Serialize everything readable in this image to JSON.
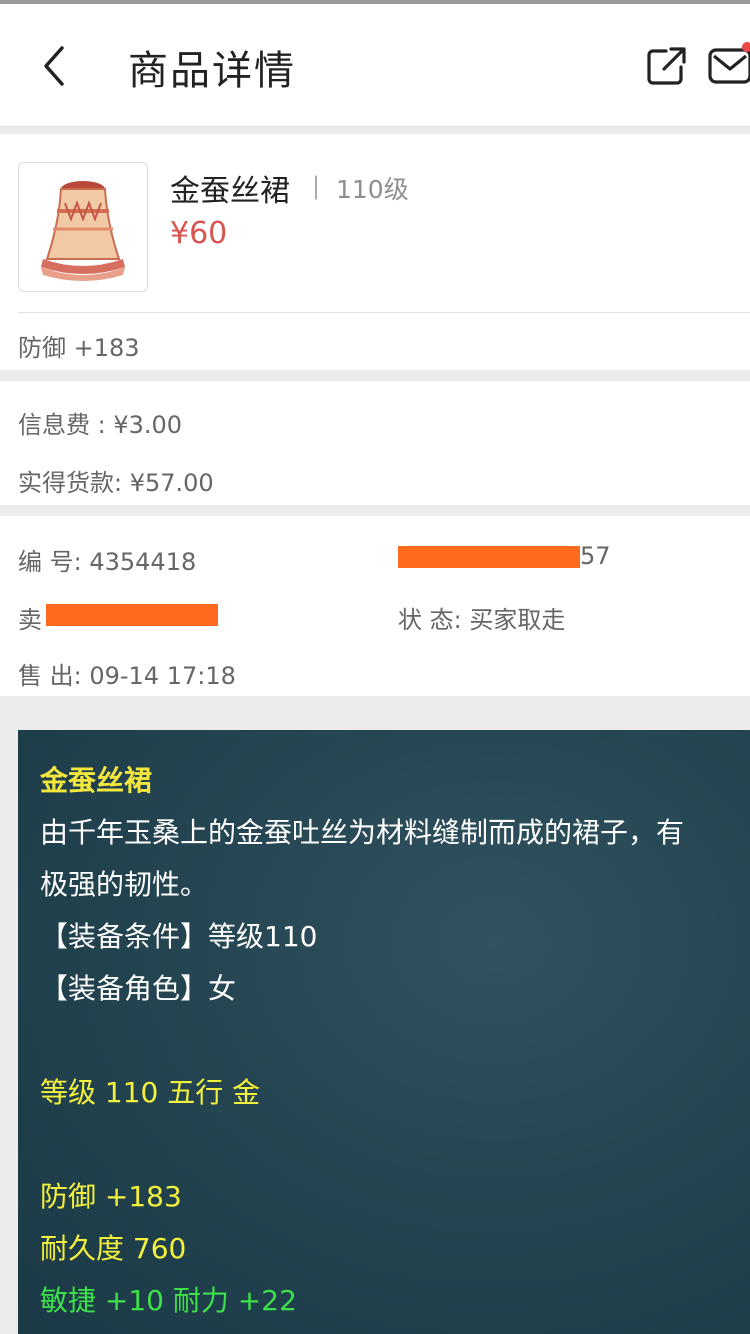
{
  "header": {
    "title": "商品详情"
  },
  "product": {
    "name": "金蚕丝裙",
    "separator": "|",
    "level": "110级",
    "price": "¥60",
    "defense": "防御 +183"
  },
  "fees": {
    "info_fee": "信息费 : ¥3.00",
    "received": "实得货款: ¥57.00"
  },
  "info": {
    "number": "编  号: 4354418",
    "right_top_suffix": "57",
    "seller_prefix": "卖",
    "status": "状  态: 买家取走",
    "sold": "售  出: 09-14 17:18"
  },
  "description": {
    "title": "金蚕丝裙",
    "line1": "由千年玉桑上的金蚕吐丝为材料缝制而成的裙子，有",
    "line2": "极强的韧性。",
    "cond_level": "【装备条件】等级110",
    "cond_role": "【装备角色】女",
    "level_element": "等级 110 五行 金",
    "defense": "防御 +183",
    "durability": "耐久度 760",
    "bonus": "敏捷 +10 耐力 +22"
  },
  "colors": {
    "price": "#d9534f",
    "panel_bg": "#244551",
    "highlight_yellow": "#f3f13c",
    "bonus_green": "#3ee04a",
    "redaction": "#ff6a1e"
  },
  "icons": [
    "back-chevron-icon",
    "share-icon",
    "mail-icon"
  ]
}
